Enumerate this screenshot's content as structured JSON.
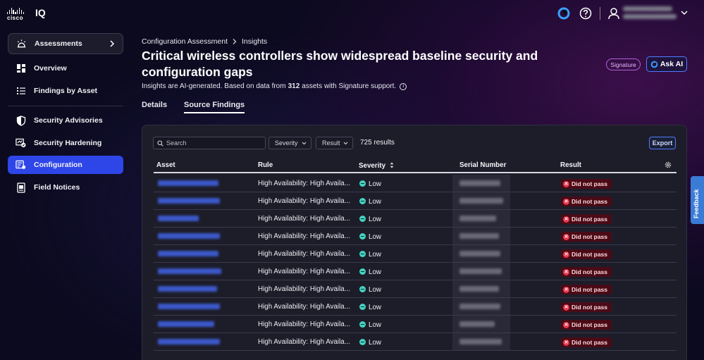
{
  "app": {
    "logo_text": "cisco",
    "name": "IQ"
  },
  "topbar": {
    "icons": [
      "ai-assistant-icon",
      "help-icon",
      "user-icon",
      "chevron-down-icon"
    ]
  },
  "sidebar": {
    "assessments_label": "Assessments",
    "items": [
      {
        "id": "overview",
        "label": "Overview",
        "icon": "dashboard-icon"
      },
      {
        "id": "findings-by-asset",
        "label": "Findings by Asset",
        "icon": "list-icon"
      },
      {
        "id": "security-advisories",
        "label": "Security Advisories",
        "icon": "shield-icon"
      },
      {
        "id": "security-hardening",
        "label": "Security Hardening",
        "icon": "hardening-icon"
      },
      {
        "id": "configuration",
        "label": "Configuration",
        "icon": "configuration-icon",
        "active": true
      },
      {
        "id": "field-notices",
        "label": "Field Notices",
        "icon": "document-icon"
      }
    ]
  },
  "breadcrumb": {
    "parent": "Configuration Assessment",
    "separator": ">",
    "current": "Insights"
  },
  "page": {
    "title": "Critical wireless controllers show widespread baseline security and configuration gaps",
    "subtitle_prefix": "Insights are AI-generated. Based on data from",
    "asset_count": "312",
    "subtitle_suffix": "assets with Signature support.",
    "signature_badge": "Signature",
    "ask_ai_label": "Ask AI"
  },
  "tabs": [
    {
      "label": "Details",
      "active": false
    },
    {
      "label": "Source Findings",
      "active": true
    }
  ],
  "toolbar": {
    "search_placeholder": "Search",
    "severity_filter": "Severity",
    "result_filter": "Result",
    "results_count": "725 results",
    "export_label": "Export"
  },
  "table": {
    "columns": [
      "Asset",
      "Rule",
      "Severity",
      "Serial Number",
      "Result"
    ],
    "rows": [
      {
        "rule": "High Availability: High Availa...",
        "severity": "Low",
        "result": "Did not pass"
      },
      {
        "rule": "High Availability: High Availa...",
        "severity": "Low",
        "result": "Did not pass"
      },
      {
        "rule": "High Availability: High Availa...",
        "severity": "Low",
        "result": "Did not pass"
      },
      {
        "rule": "High Availability: High Availa...",
        "severity": "Low",
        "result": "Did not pass"
      },
      {
        "rule": "High Availability: High Availa...",
        "severity": "Low",
        "result": "Did not pass"
      },
      {
        "rule": "High Availability: High Availa...",
        "severity": "Low",
        "result": "Did not pass"
      },
      {
        "rule": "High Availability: High Availa...",
        "severity": "Low",
        "result": "Did not pass"
      },
      {
        "rule": "High Availability: High Availa...",
        "severity": "Low",
        "result": "Did not pass"
      },
      {
        "rule": "High Availability: High Availa...",
        "severity": "Low",
        "result": "Did not pass"
      },
      {
        "rule": "High Availability: High Availa...",
        "severity": "Low",
        "result": "Did not pass"
      }
    ]
  },
  "feedback_label": "Feedback",
  "colors": {
    "accent": "#2e46e8",
    "severity_low": "#45d3c2",
    "fail": "#e8344c",
    "signature": "#b25fd6"
  }
}
